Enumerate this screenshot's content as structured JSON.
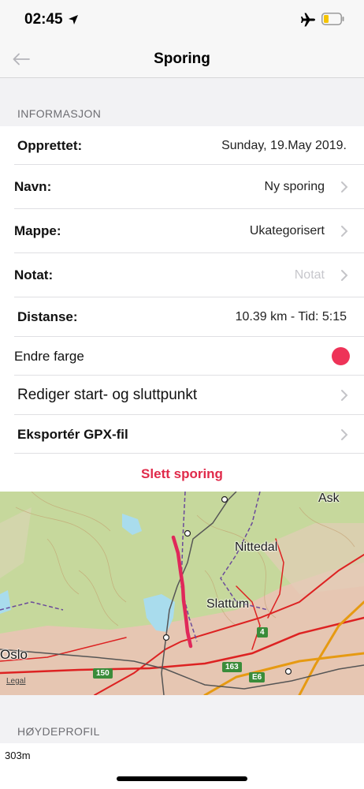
{
  "status_bar": {
    "time": "02:45",
    "icons": [
      "location-arrow-icon",
      "airplane-icon",
      "battery-icon"
    ],
    "battery_color": "#f5c400"
  },
  "nav": {
    "back_icon": "back-arrow-icon",
    "title": "Sporing"
  },
  "info_section": {
    "header": "INFORMASJON",
    "rows": [
      {
        "label": "Opprettet:",
        "value": "Sunday, 19.May 2019."
      },
      {
        "label": "Navn:",
        "value": "Ny sporing"
      },
      {
        "label": "Mappe:",
        "value": "Ukategorisert"
      },
      {
        "label": "Notat:",
        "value": "Notat"
      },
      {
        "label": "Distanse:",
        "value": "10.39 km - Tid: 5:15"
      },
      {
        "label": "Endre farge",
        "value": ""
      },
      {
        "label": "Rediger start- og sluttpunkt",
        "value": ""
      },
      {
        "label": "Eksportér GPX-fil",
        "value": ""
      }
    ],
    "delete_label": "Slett sporing",
    "track_color": "#ee3358",
    "accent_red": "#e02a4a"
  },
  "map": {
    "labels": {
      "ask": "Ask",
      "nittedal": "Nittedal",
      "slattum": "Slattum",
      "oslo": "Oslo"
    },
    "road_badges": [
      "150",
      "163",
      "E6",
      "4"
    ],
    "legal": "Legal"
  },
  "profile_section": {
    "header": "HØYDEPROFIL",
    "elevation": "303m"
  }
}
